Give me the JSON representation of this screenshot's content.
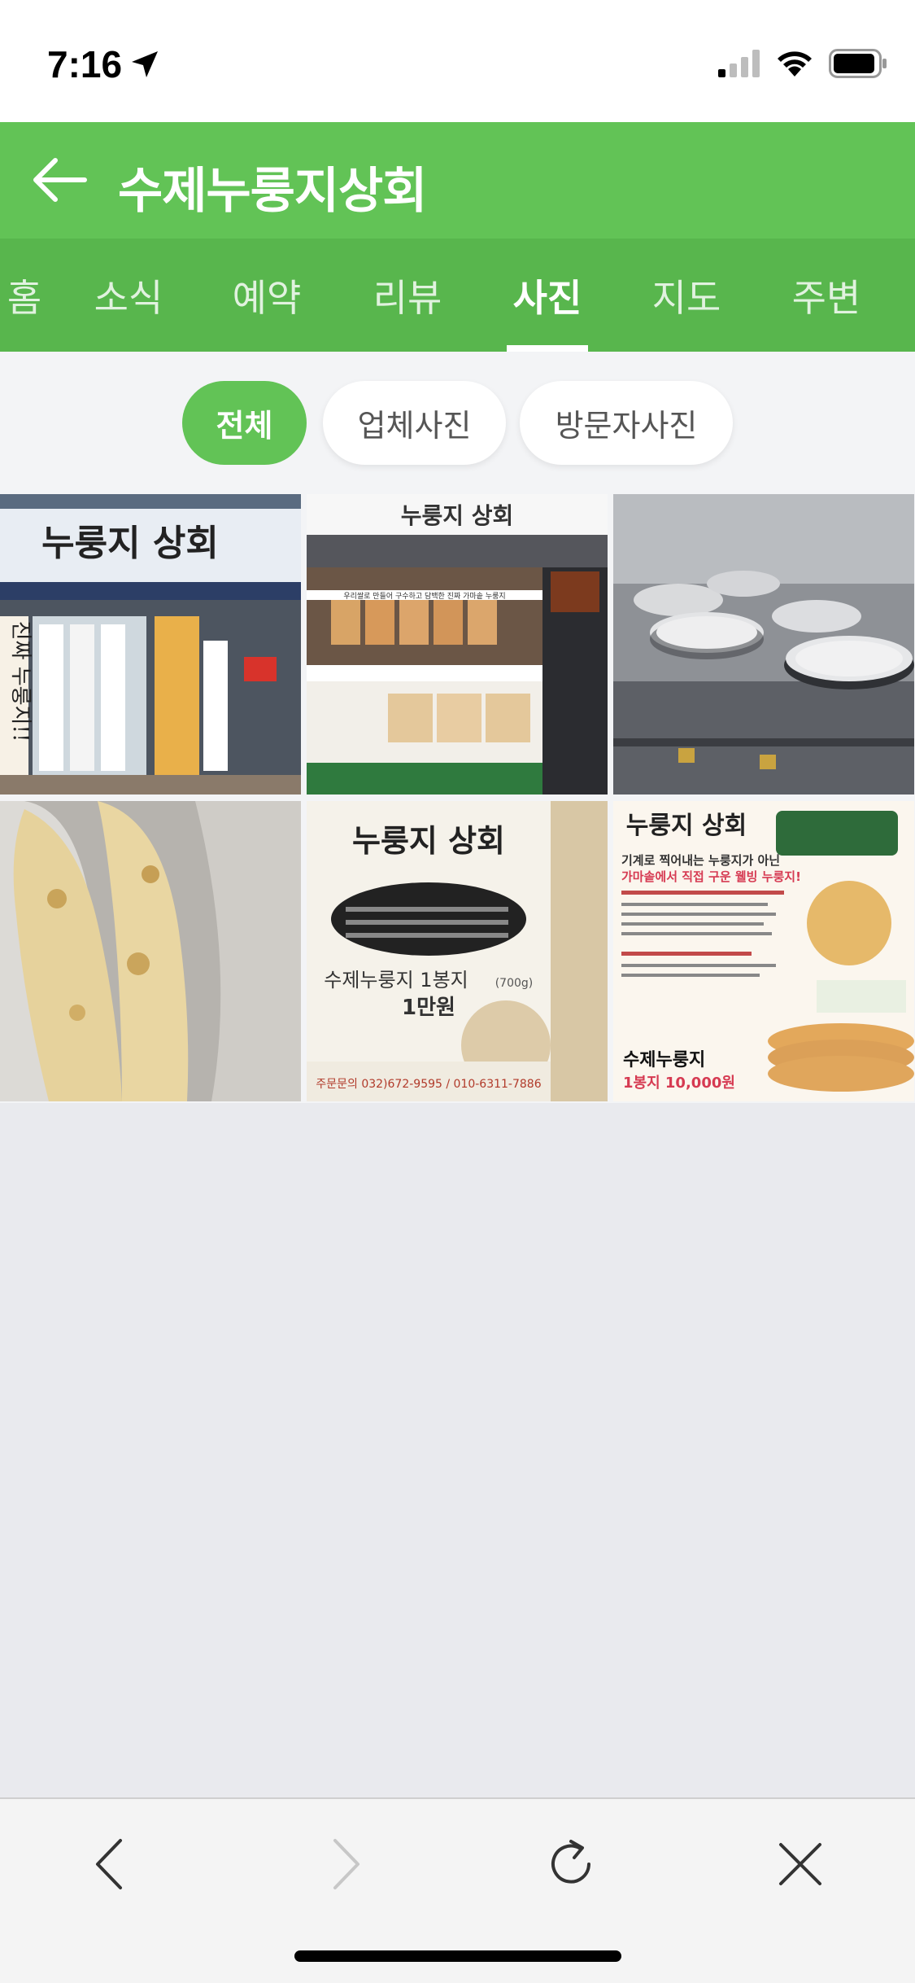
{
  "status_bar": {
    "time": "7:16"
  },
  "header": {
    "title": "수제누룽지상회"
  },
  "tabs": [
    {
      "label": "홈"
    },
    {
      "label": "소식"
    },
    {
      "label": "예약"
    },
    {
      "label": "리뷰"
    },
    {
      "label": "사진",
      "active": true
    },
    {
      "label": "지도"
    },
    {
      "label": "주변"
    }
  ],
  "filters": [
    {
      "label": "전체",
      "active": true
    },
    {
      "label": "업체사진"
    },
    {
      "label": "방문자사진"
    }
  ],
  "photos": [
    {
      "sign_text": "누룽지 상회",
      "side_text": "진짜 누룽지!!"
    },
    {
      "sign_text": "누룽지 상회",
      "banner_text": "우리쌀로 만들어 구수하고 담백한 진짜 가마솥 누룽지"
    },
    {
      "sign_text": ""
    },
    {
      "sign_text": ""
    },
    {
      "sign_text": "누룽지 상회",
      "product_text": "수제누룽지 1봉지",
      "weight_text": "(700g)",
      "price_text": "1만원",
      "phone_text": "주문문의 032)672-9595 / 010-6311-7886"
    },
    {
      "sign_text": "누룽지 상회",
      "headline_1": "기계로 찍어내는 누룽지가 아닌",
      "headline_2": "가마솥에서 직접 구운 웰빙 누룽지!",
      "product_text": "수제누룽지",
      "price_text": "1봉지 10,000원"
    }
  ],
  "colors": {
    "brand_green": "#62c356",
    "tab_green": "#58b64d"
  }
}
